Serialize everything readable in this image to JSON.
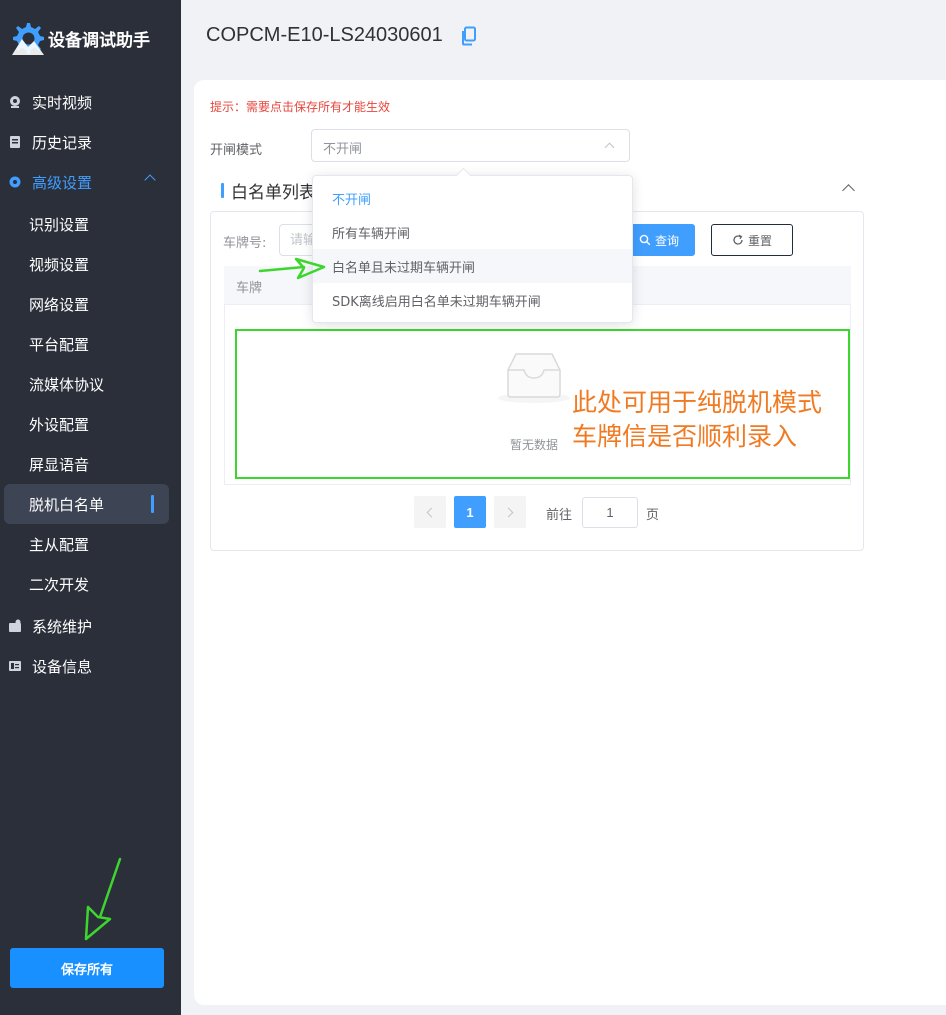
{
  "app": {
    "title": "设备调试助手",
    "device_id": "COPCM-E10-LS24030601"
  },
  "sidebar": {
    "items": [
      {
        "label": "实时视频",
        "icon": "video-icon"
      },
      {
        "label": "历史记录",
        "icon": "history-icon"
      },
      {
        "label": "高级设置",
        "icon": "settings-icon",
        "expanded": true
      },
      {
        "label": "系统维护",
        "icon": "maintenance-icon"
      },
      {
        "label": "设备信息",
        "icon": "info-icon"
      }
    ],
    "sub_items": [
      {
        "label": "识别设置"
      },
      {
        "label": "视频设置"
      },
      {
        "label": "网络设置"
      },
      {
        "label": "平台配置"
      },
      {
        "label": "流媒体协议"
      },
      {
        "label": "外设配置"
      },
      {
        "label": "屏显语音"
      },
      {
        "label": "脱机白名单",
        "active": true
      },
      {
        "label": "主从配置"
      },
      {
        "label": "二次开发"
      }
    ],
    "save_all_label": "保存所有"
  },
  "main": {
    "hint": "提示：需要点击保存所有才能生效",
    "gate_mode": {
      "label": "开闸模式",
      "value": "不开闸",
      "options": [
        {
          "label": "不开闸",
          "selected": true
        },
        {
          "label": "所有车辆开闸"
        },
        {
          "label": "白名单且未过期车辆开闸",
          "hovered": true
        },
        {
          "label": "SDK离线启用白名单未过期车辆开闸"
        }
      ]
    },
    "whitelist": {
      "title": "白名单列表",
      "plate_label": "车牌号:",
      "plate_placeholder": "请输",
      "query_label": "查询",
      "reset_label": "重置",
      "table_header": "车牌",
      "empty_text": "暂无数据"
    },
    "pagination": {
      "current_page": "1",
      "goto_label": "前往",
      "goto_value": "1",
      "page_suffix": "页"
    }
  },
  "annotation": {
    "line1": "此处可用于纯脱机模式",
    "line2": "车牌信是否顺利录入"
  },
  "colors": {
    "sidebar_bg": "#2b2f3a",
    "accent": "#409eff",
    "hint_red": "#e6463c",
    "annotation_orange": "#f07a22",
    "annotation_green": "#3dd62e"
  }
}
